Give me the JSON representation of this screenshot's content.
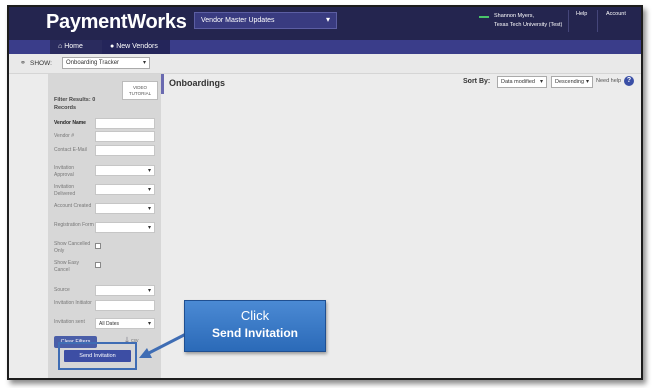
{
  "header": {
    "logo": "PaymentWorks",
    "vendor_select": "Vendor Master Updates",
    "user_name": "Shannon Myers,",
    "user_org": "Texas Tech University (Test)",
    "help": "Help",
    "account": "Account"
  },
  "nav": {
    "home": "Home",
    "new_vendors": "New Vendors"
  },
  "show": {
    "label": "SHOW:",
    "selected": "Onboarding Tracker"
  },
  "sidebar": {
    "video_tutorial_line1": "VIDEO",
    "video_tutorial_line2": "TUTORIAL",
    "filter_results": "Filter Results: 0 Records",
    "vendor_name": "Vendor Name",
    "vendor_number": "Vendor #",
    "contact_email": "Contact E-Mail",
    "invitation_approval": "Invitation Approval",
    "invitation_delivered": "Invitation Delivered",
    "account_created": "Account Created",
    "registration_form": "Registration Form",
    "show_cancelled": "Show Cancelled Only",
    "show_easy_cancel": "Show Easy Cancel",
    "source": "Source",
    "invitation_initiator": "Invitation Initiator",
    "invitation_sent": "Invitation sent",
    "invitation_sent_value": "All Dates",
    "clear_filters": "Clear Filters",
    "csv": "csv",
    "send_invitation": "Send Invitation"
  },
  "content": {
    "title": "Onboardings",
    "sort_by": "Sort By:",
    "sort_field": "Data modified",
    "sort_order": "Descending",
    "need_help": "Need help"
  },
  "callout": {
    "line1": "Click",
    "line2": "Send Invitation"
  },
  "colors": {
    "header_bg": "#24254f",
    "nav_bg": "#3a3d8a",
    "callout_blue": "#3a7bc8",
    "button_blue": "#3d4ea4"
  }
}
